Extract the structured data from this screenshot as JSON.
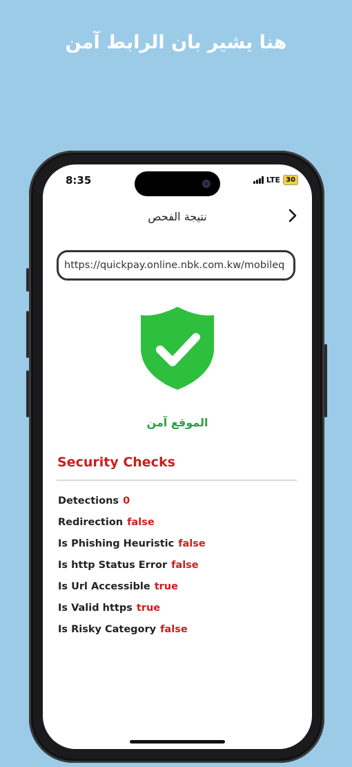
{
  "banner": {
    "text": "هنا يشير بان الرابط آمن"
  },
  "status_bar": {
    "time": "8:35",
    "network": "LTE",
    "battery": "30"
  },
  "nav": {
    "title": "نتيجة الفحص",
    "back_icon": "chevron-right-icon"
  },
  "url_field": {
    "value": "https://quickpay.online.nbk.com.kw/mobileq"
  },
  "result": {
    "icon": "green-shield-check-icon",
    "status_text": "الموقع آمن",
    "status_color": "#2ea043"
  },
  "security_checks": {
    "title": "Security Checks",
    "items": [
      {
        "label": "Detections",
        "value": "0"
      },
      {
        "label": "Redirection",
        "value": "false"
      },
      {
        "label": "Is Phishing Heuristic",
        "value": "false"
      },
      {
        "label": "Is http Status Error",
        "value": "false"
      },
      {
        "label": "Is Url Accessible",
        "value": "true"
      },
      {
        "label": "Is Valid https",
        "value": "true"
      },
      {
        "label": "Is Risky Category",
        "value": "false"
      }
    ]
  },
  "colors": {
    "background": "#9ccbe8",
    "accent_red": "#c81e1e",
    "shield_green": "#2fbf3f"
  }
}
